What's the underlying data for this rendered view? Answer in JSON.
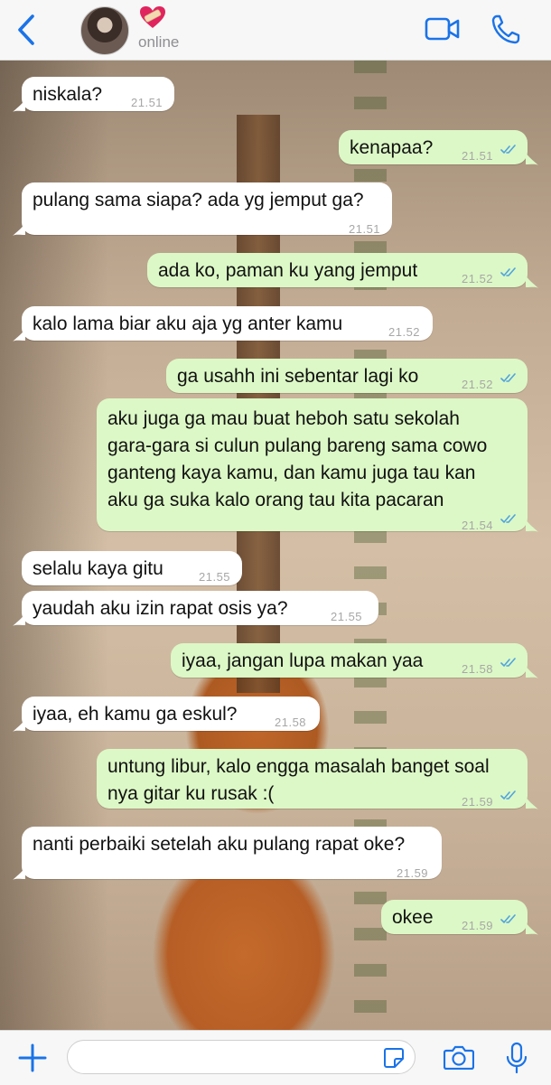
{
  "header": {
    "contact_status": "online",
    "contact_emoji": "heart-with-bandage",
    "accent_color": "#1a73e8"
  },
  "messages": [
    {
      "dir": "in",
      "text": "niskala?",
      "time": "21.51"
    },
    {
      "dir": "out",
      "text": "kenapaa?",
      "time": "21.51",
      "read": true
    },
    {
      "dir": "in",
      "text": "pulang sama siapa? ada yg jemput ga?",
      "time": "21.51"
    },
    {
      "dir": "out",
      "text": "ada ko, paman ku yang jemput",
      "time": "21.52",
      "read": true
    },
    {
      "dir": "in",
      "text": "kalo lama biar aku aja yg anter kamu",
      "time": "21.52"
    },
    {
      "dir": "out",
      "text": "ga usahh ini sebentar lagi ko",
      "time": "21.52",
      "read": true
    },
    {
      "dir": "out",
      "text": "aku juga ga mau buat heboh satu sekolah\ngara-gara si culun pulang bareng sama cowo\nganteng kaya kamu, dan kamu juga tau kan\naku ga suka kalo orang tau kita pacaran",
      "time": "21.54",
      "read": true
    },
    {
      "dir": "in",
      "text": "selalu kaya gitu",
      "time": "21.55"
    },
    {
      "dir": "in",
      "text": "yaudah aku izin rapat osis ya?",
      "time": "21.55"
    },
    {
      "dir": "out",
      "text": "iyaa, jangan lupa makan yaa",
      "time": "21.58",
      "read": true
    },
    {
      "dir": "in",
      "text": "iyaa, eh kamu ga eskul?",
      "time": "21.58"
    },
    {
      "dir": "out",
      "text": "untung libur, kalo engga masalah banget soal\nnya gitar ku rusak :(",
      "time": "21.59",
      "read": true
    },
    {
      "dir": "in",
      "text": "nanti perbaiki setelah aku pulang rapat oke?",
      "time": "21.59"
    },
    {
      "dir": "out",
      "text": "okee",
      "time": "21.59",
      "read": true
    }
  ],
  "composer": {
    "input_value": "",
    "input_placeholder": ""
  },
  "colors": {
    "incoming_bubble": "#ffffff",
    "outgoing_bubble": "#dcf8c6",
    "read_tick": "#4fa3e0",
    "icon_blue": "#1a73e8"
  }
}
